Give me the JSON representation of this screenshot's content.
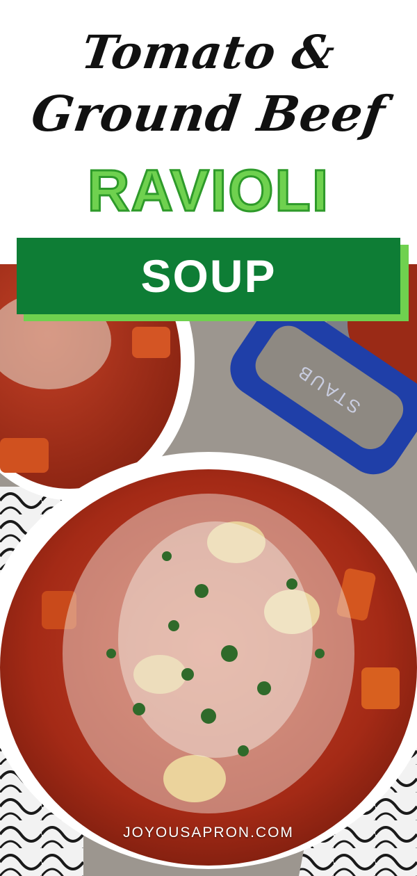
{
  "title": {
    "line1": "Tomato &",
    "line2": "Ground Beef",
    "line3": "RAVIOLI",
    "banner": "SOUP"
  },
  "pot_handle_text": "STAUB",
  "watermark": "JOYOUSAPRON.COM",
  "colors": {
    "accent_green": "#6fd14f",
    "banner_green": "#0e7d35",
    "pot_blue": "#1f3fa8",
    "soup_red": "#b8331c"
  }
}
